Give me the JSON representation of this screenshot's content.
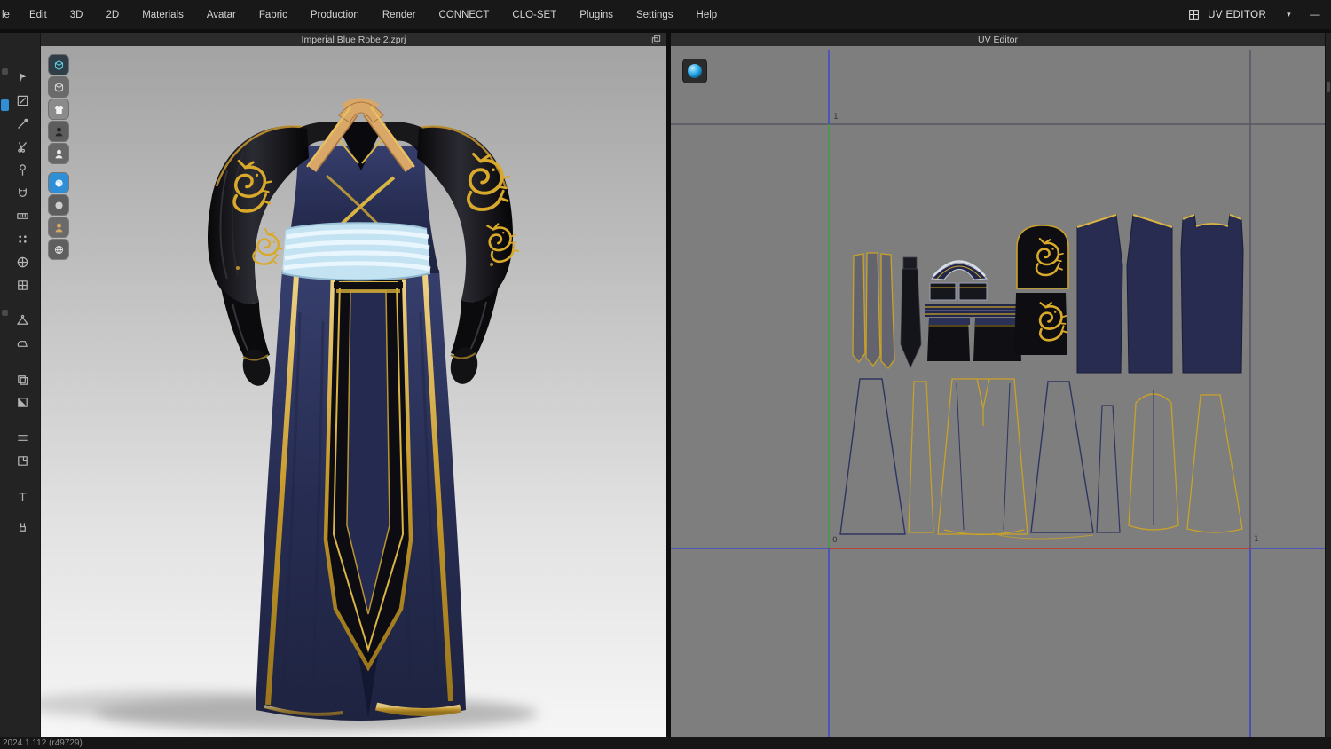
{
  "menu_bar": {
    "items": [
      {
        "label": "le"
      },
      {
        "label": "Edit"
      },
      {
        "label": "3D"
      },
      {
        "label": "2D"
      },
      {
        "label": "Materials"
      },
      {
        "label": "Avatar"
      },
      {
        "label": "Fabric"
      },
      {
        "label": "Production"
      },
      {
        "label": "Render"
      },
      {
        "label": "CONNECT"
      },
      {
        "label": "CLO-SET"
      },
      {
        "label": "Plugins"
      },
      {
        "label": "Settings"
      },
      {
        "label": "Help"
      }
    ],
    "mode": {
      "icon": "uv-grid-icon",
      "label": "UV EDITOR",
      "caret": "▾",
      "collapse": "—"
    }
  },
  "panels": {
    "viewport3d": {
      "title": "Imperial Blue Robe 2.zprj",
      "undock_icon": "undock-window-icon"
    },
    "uv_editor": {
      "title": "UV Editor",
      "axis_labels": {
        "v1": "1",
        "origin": "0",
        "u1": "1"
      },
      "material_thumbnail": "blue-material-sphere-icon"
    }
  },
  "toolbars": {
    "left_tools": {
      "icon_names": [
        "cursor-tool-icon",
        "box-edit-tool-icon",
        "pen-tool-icon",
        "scissors-tool-icon",
        "pin-tool-icon",
        "magnet-tool-icon",
        "tape-tool-icon",
        "dot-grid-tool-icon",
        "sphere-tool-icon",
        "split-tool-icon",
        "hanger-tool-icon",
        "iron-tool-icon",
        "layers-tool-icon",
        "fill-tool-icon",
        "list-tool-icon",
        "fold-tool-icon",
        "t-pin-tool-icon",
        "plug-tool-icon"
      ]
    },
    "view_toggles": {
      "icon_names": [
        "cube-dark-icon",
        "cube-light-icon",
        "shirt-icon",
        "bust-icon",
        "person-icon",
        "sphere-blue-icon",
        "sphere-gray-icon",
        "person-tan-icon",
        "globe-icon"
      ],
      "active_index": 5
    }
  },
  "uv_pieces": [
    "collar-strips",
    "tie",
    "neckband",
    "small-bands",
    "belt",
    "cuff-left",
    "cuff-right",
    "dragon-emblem-1",
    "dragon-emblem-2",
    "front-bodice-left",
    "front-bodice-right",
    "back-bodice",
    "skirt-outline-1",
    "strip-outline-1",
    "skirt-front-outline",
    "skirt-outline-2",
    "strip-outline-2",
    "sleeve-outline",
    "skirt-outline-3",
    "hem-outline"
  ],
  "status_bar": {
    "version": "2024.1.112 (r49729)"
  },
  "colors": {
    "accent_blue": "#2f8fd6",
    "gold": "#c9a227",
    "navy": "#2a3055",
    "belt_blue": "#c4e3f2",
    "collar_tan": "#d9a868",
    "uv_axis_red": "#c03b33",
    "uv_axis_green": "#3f9b45",
    "uv_axis_blue": "#3c49cc",
    "uv_background": "#7e7e7e"
  }
}
